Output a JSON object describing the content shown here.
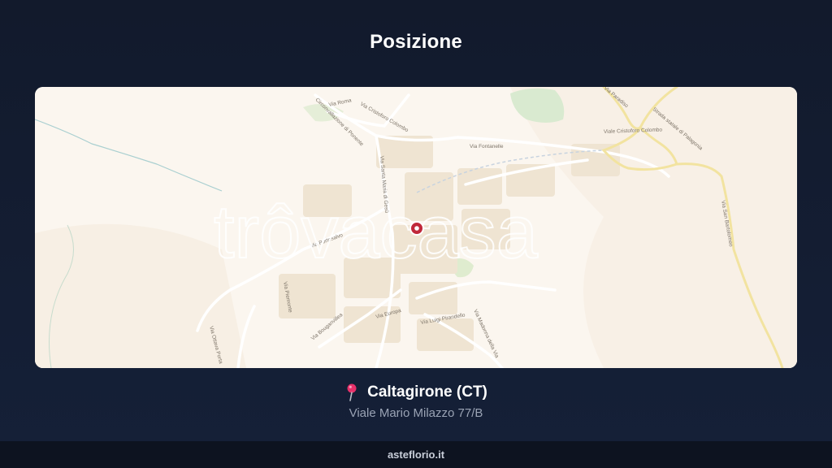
{
  "page": {
    "title": "Posizione"
  },
  "map": {
    "watermark": "trôvacasa",
    "streets": [
      "Viale Cristoforo Colombo",
      "Via Fontanelle",
      "Via Cristoforo Colombo",
      "Circonvallazione di Ponente",
      "Via Roma",
      "Via Santa Maria di Gesù",
      "Via Portosalvo",
      "Via Ottava Porta",
      "Via Madonna della Via",
      "Via Luigi Pirandello",
      "Via Europa",
      "Via Bouganvillea",
      "Via San Bartolomeo",
      "Strada statale di Palagonia",
      "Via Paradiso",
      "Via Piemonte"
    ],
    "marker_icon": "location-pin-icon"
  },
  "location": {
    "icon": "pushpin-icon",
    "city": "Caltagirone (CT)",
    "address": "Viale Mario Milazzo 77/B"
  },
  "footer": {
    "site": "asteflorio.it"
  },
  "colors": {
    "background": "#131b2e",
    "map_land": "#fbf6ef",
    "marker": "#c0283a",
    "address_text": "#9aa3b4"
  }
}
